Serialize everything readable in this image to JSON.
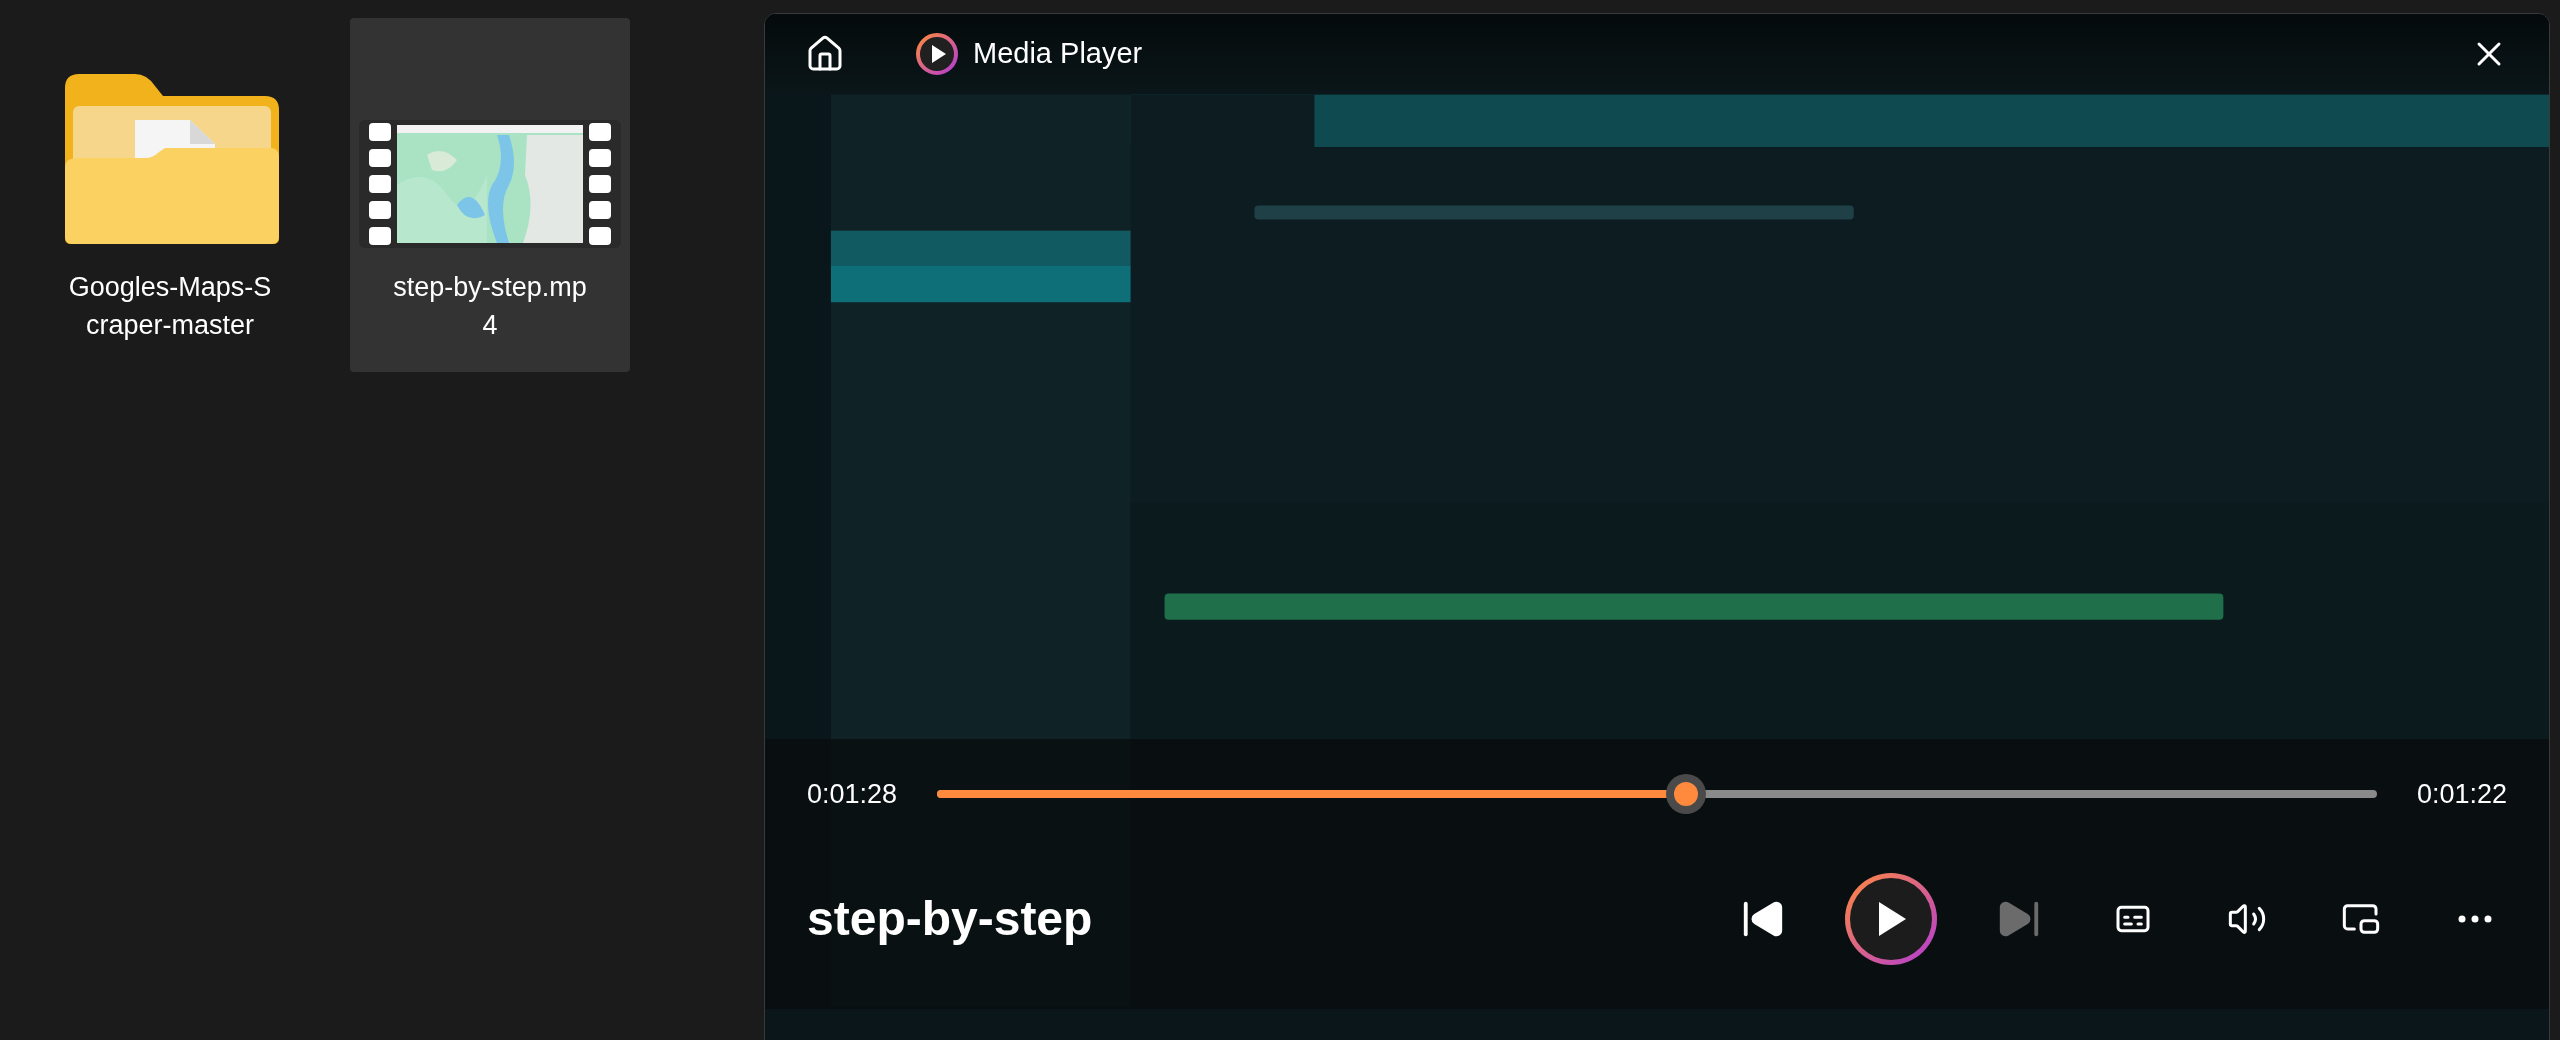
{
  "desktop": {
    "items": [
      {
        "kind": "folder",
        "label_lines": [
          "Googles-Maps-S",
          "craper-master"
        ],
        "selected": false
      },
      {
        "kind": "video",
        "label_lines": [
          "step-by-step.mp",
          "4"
        ],
        "selected": true
      }
    ]
  },
  "player": {
    "title": "Media Player",
    "elapsed": "0:01:28",
    "remaining": "0:01:22",
    "progress": {
      "level": 0.52
    },
    "video_title": "step-by-step",
    "controls": [
      {
        "kind": "previous",
        "disabled": false
      },
      {
        "kind": "play",
        "disabled": false
      },
      {
        "kind": "next",
        "disabled": true
      },
      {
        "kind": "captions",
        "disabled": false
      },
      {
        "kind": "volume",
        "disabled": false
      },
      {
        "kind": "mini-view",
        "disabled": false
      },
      {
        "kind": "more",
        "disabled": false
      }
    ]
  }
}
